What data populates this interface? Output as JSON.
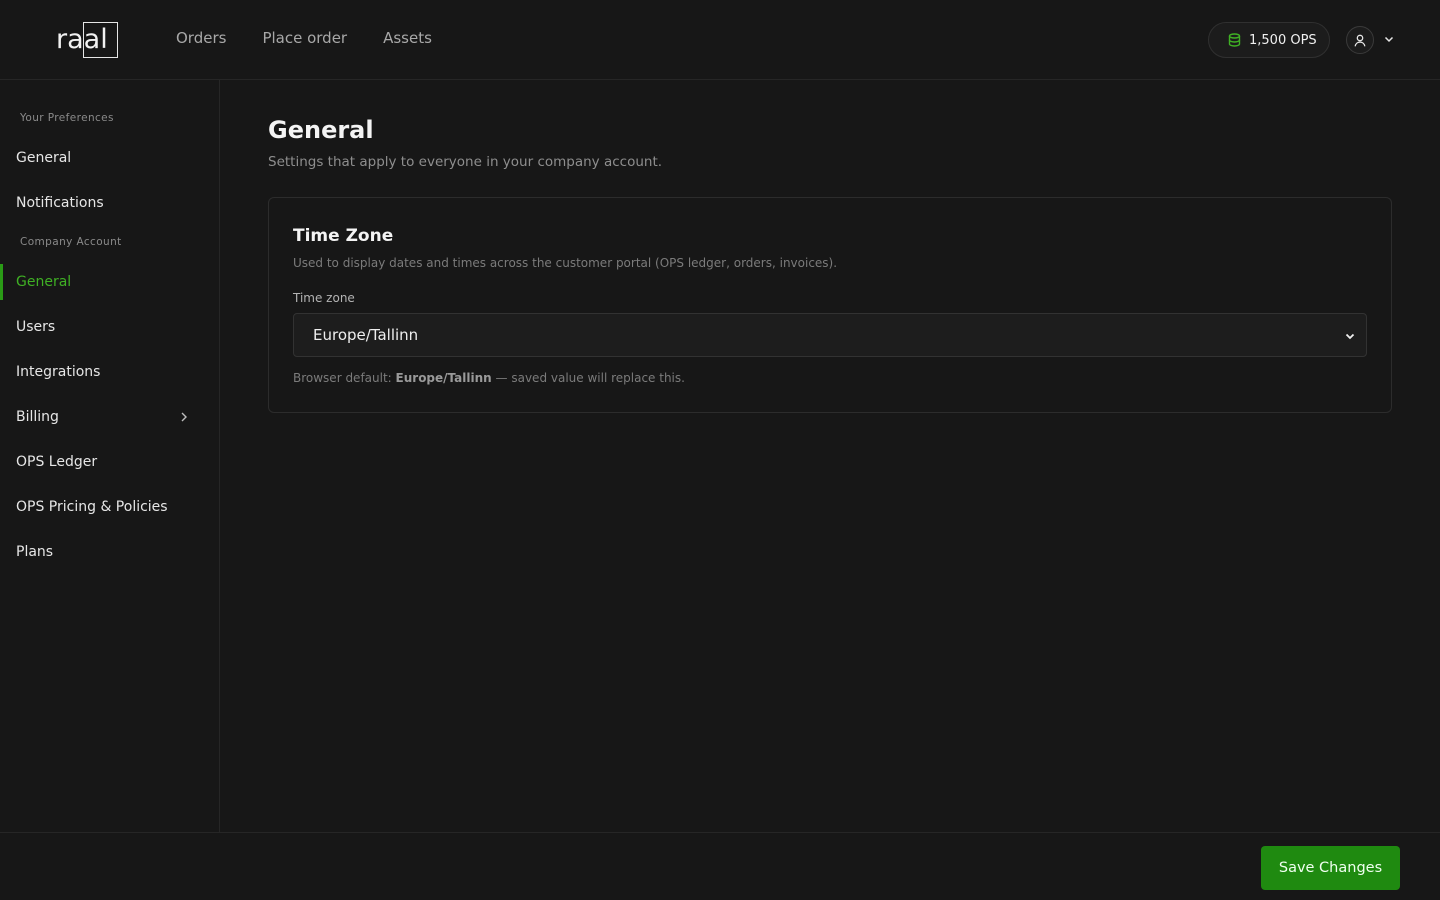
{
  "brand": {
    "logo_text": "raal"
  },
  "nav": {
    "items": [
      "Orders",
      "Place order",
      "Assets"
    ]
  },
  "header": {
    "ops_balance": "1,500 OPS",
    "ops_icon": "coins-icon",
    "user_icon": "user-icon"
  },
  "sidebar": {
    "section_preferences": "Your Preferences",
    "preferences_items": [
      "General",
      "Notifications"
    ],
    "section_company": "Company Account",
    "company_items": [
      "General",
      "Users",
      "Integrations",
      "Billing",
      "OPS Ledger",
      "OPS Pricing & Policies",
      "Plans"
    ],
    "active_item": "General"
  },
  "page": {
    "title": "General",
    "subtitle": "Settings that apply to everyone in your company account."
  },
  "timezone_card": {
    "title": "Time Zone",
    "description": "Used to display dates and times across the customer portal (OPS ledger, orders, invoices).",
    "field_label": "Time zone",
    "selected_value": "Europe/Tallinn",
    "browser_default_prefix": "Browser default: ",
    "browser_default_value": "Europe/Tallinn",
    "browser_default_suffix": " — saved value will replace this."
  },
  "footer": {
    "save_label": "Save Changes"
  },
  "colors": {
    "accent": "#2a9b16",
    "active_text": "#3fb024",
    "background": "#171717"
  }
}
